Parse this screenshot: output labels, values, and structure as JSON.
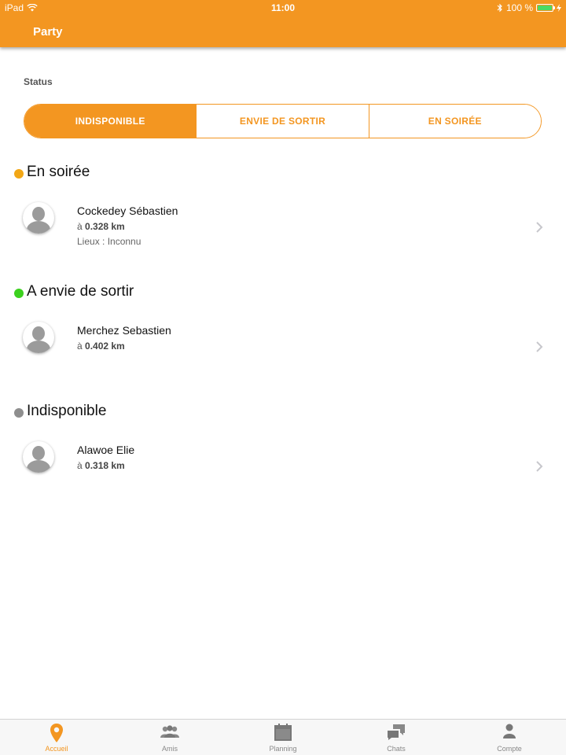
{
  "statusbar": {
    "device": "iPad",
    "time": "11:00",
    "battery": "100 %"
  },
  "header": {
    "title": "Party"
  },
  "status": {
    "label": "Status",
    "options": [
      "INDISPONIBLE",
      "ENVIE DE SORTIR",
      "EN SOIRÉE"
    ],
    "selected": "INDISPONIBLE"
  },
  "groups": [
    {
      "title": "En soirée",
      "color": "#f2a716",
      "items": [
        {
          "name": "Cockedey Sébastien",
          "dist_prefix": "à ",
          "dist": "0.328 km",
          "lieux": "Lieux : Inconnu"
        }
      ]
    },
    {
      "title": "A envie de sortir",
      "color": "#3cd11e",
      "items": [
        {
          "name": "Merchez Sebastien",
          "dist_prefix": "à ",
          "dist": "0.402 km"
        }
      ]
    },
    {
      "title": "Indisponible",
      "color": "#8e8e8e",
      "items": [
        {
          "name": "Alawoe Elie",
          "dist_prefix": "à ",
          "dist": "0.318 km"
        }
      ]
    }
  ],
  "tabs": [
    {
      "label": "Accueil",
      "icon": "map-pin-icon",
      "active": true
    },
    {
      "label": "Amis",
      "icon": "people-icon",
      "active": false
    },
    {
      "label": "Planning",
      "icon": "calendar-icon",
      "active": false
    },
    {
      "label": "Chats",
      "icon": "chat-bubbles-icon",
      "active": false
    },
    {
      "label": "Compte",
      "icon": "person-icon",
      "active": false
    }
  ],
  "colors": {
    "accent": "#f39621"
  }
}
